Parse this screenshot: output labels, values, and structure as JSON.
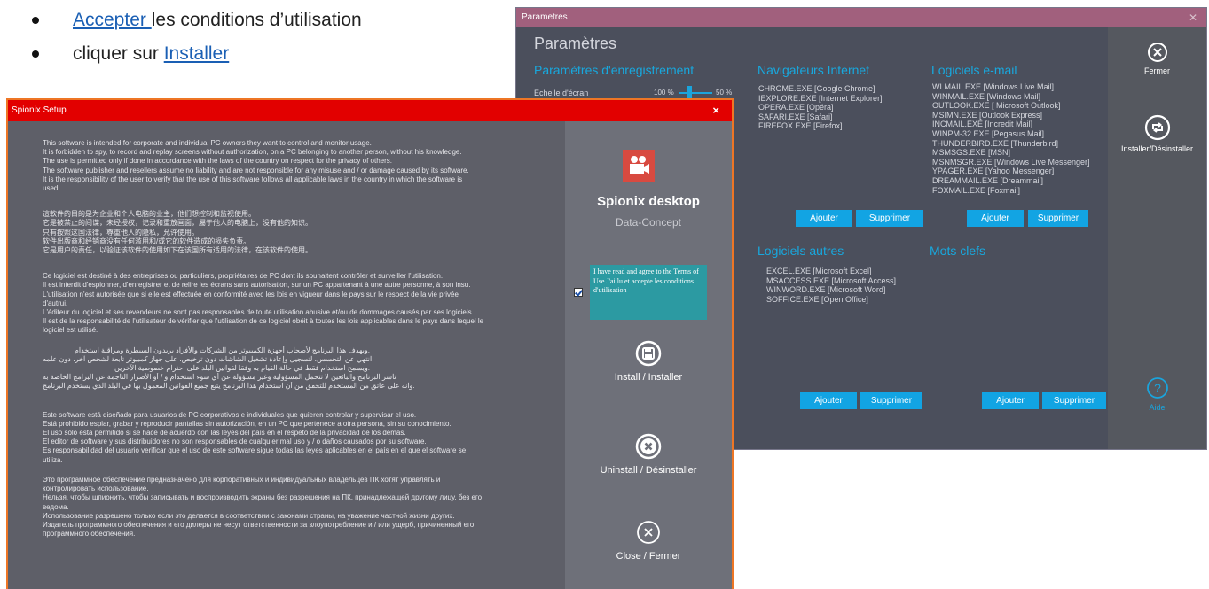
{
  "instructions": {
    "item1": {
      "link": "Accepter ",
      "text": "les conditions d’utilisation"
    },
    "item2": {
      "text": "cliquer sur ",
      "link": "Installer"
    }
  },
  "params": {
    "window_title": "Parametres",
    "page_title": "Paramètres",
    "recording_section": "Paramètres d'enregistrement",
    "scale_label": "Echelle d'écran",
    "scale_value_left": "100 %",
    "scale_value_right": "50 %",
    "browsers_section": "Navigateurs Internet",
    "browsers": [
      "CHROME.EXE [Google Chrome]",
      "IEXPLORE.EXE [Internet Explorer]",
      "OPERA.EXE [Opéra]",
      "SAFARI.EXE [Safari]",
      "FIREFOX.EXE [Firefox]"
    ],
    "email_section": "Logiciels e-mail",
    "email_clients": [
      "WLMAIL.EXE [Windows Live Mail]",
      "WINMAIL.EXE [Windows Mail]",
      "OUTLOOK.EXE [ Microsoft Outlook]",
      "MSIMN.EXE [Outlook Express]",
      "INCMAIL.EXE [Incredit Mail]",
      "WINPM-32.EXE [Pegasus Mail]",
      "THUNDERBIRD.EXE [Thunderbird]",
      "MSMSGS.EXE [MSN]",
      "MSNMSGR.EXE [Windows Live Messenger]",
      "YPAGER.EXE [Yahoo Messenger]",
      "DREAMMAIL.EXE [Dreammail]",
      "FOXMAIL.EXE [Foxmail]"
    ],
    "other_section": "Logiciels autres",
    "other_software": [
      "EXCEL.EXE [Microsoft Excel]",
      "MSACCESS.EXE [Microsoft Access]",
      "WINWORD.EXE [Microsoft Word]",
      "SOFFICE.EXE [Open Office]"
    ],
    "keywords_section": "Mots clefs",
    "add_label": "Ajouter",
    "remove_label": "Supprimer",
    "close_label": "Fermer",
    "install_uninstall_label": "Installer/Désinstaller",
    "help_label": "Aide"
  },
  "setup": {
    "window_title": "Spionix Setup",
    "close_x": "×",
    "english": [
      "This software is intended for corporate and individual PC owners they want to control and monitor usage.",
      "It is forbidden to spy, to record and replay screens without authorization, on a PC belonging to another person, without his knowledge.",
      "The use is permitted only if done in accordance with the laws of the country on respect for the privacy of others.",
      "The software publisher and resellers assume no liability and are not responsible for any misuse and / or damage caused by its software.",
      "It is the responsibility of the user to verify that the use of this software follows all applicable laws in the country in which the software is",
      "used."
    ],
    "chinese": [
      "這軟件的目的是为企业和个人电脑的业主，他们想控制和监视使用。",
      "它是被禁止的间谍，未经授权，记录和重放画面，屬于他人的电脑上，没有他的知识。",
      "只有按照这国法律，尊重他人的隐私，允许使用。",
      "软件出版商和经销商没有任何滥用和/或它的软件造成的损失负责。",
      "它是用户的责任，以验证该软件的使用如下在该国所有适用的法律，在该软件的使用。"
    ],
    "french": [
      "Ce logiciel est destiné à des entreprises ou particuliers, propriétaires de PC dont ils souhaitent contrôler et surveiller l'utilisation.",
      "Il est interdit d'espionner, d'enregistrer et de relire les écrans sans autorisation, sur un PC appartenant à une autre personne, à son insu.",
      "L'utilisation n'est autorisée que  si elle est effectuée en conformité avec les lois en vigueur dans le pays sur le respect de la vie privée",
      "d'autrui.",
      "L'éditeur du logiciel et ses revendeurs ne sont pas responsables de toute utilisation abusive et/ou de dommages causés par ses logiciels.",
      "Il est de la responsabilité de l'utilisateur de vérifier que l'utilisation de ce logiciel obéit à toutes les lois applicables dans le pays dans lequel le",
      "logiciel est utilisé."
    ],
    "arabic": [
      "ويهدف هذا البرنامج لأصحاب أجهزة الكمبيوتر من الشركات والأفراد يريدون السيطرة ومراقبة استخدام.",
      "انتهي عن التجسس، لتسجيل وإعادة تشغيل الشاشات دون ترخيص، على جهاز كمبيوتر تابعة لشخص آخر، دون علمه",
      "ويسمح استخدام فقط في حالة القيام به وفقا لقوانين البلد على احترام خصوصية الآخرين.",
      "ناشر البرنامج والبائعين لا تتحمل المسؤولية وغير مسؤولة عن أي سوء استخدام و / أو الأضرار الناجمة عن البرامج الخاصة به",
      "وانه على عاتق من المستخدم للتحقق من أن استخدام هذا البرنامج يتبع جميع القوانين المعمول بها في البلد الذي يستخدم البرنامج."
    ],
    "spanish": [
      "Este software está diseñado para usuarios de PC corporativos e individuales que quieren controlar y supervisar el uso.",
      "Está prohibido espiar, grabar y reproducir pantallas sin autorización, en un PC que pertenece a otra persona, sin su conocimiento.",
      "El uso sólo está permitido si se hace de acuerdo con las leyes del país en el respeto de la privacidad de los demás.",
      "El editor de software y sus distribuidores no son responsables de cualquier mal uso y / o daños causados por su software.",
      "Es responsabilidad del usuario verificar que el uso de este software sigue todas las leyes aplicables en el país en el que el software se",
      "utiliza."
    ],
    "russian": [
      "Это программное обеспечение предназначено для корпоративных и индивидуальных владельцев ПК хотят управлять и",
      "контролировать использование.",
      "Нельзя, чтобы шпионить, чтобы записывать и воспроизводить экраны без разрешения на ПК, принадлежащей другому лицу, без его",
      "ведома.",
      "Использование разрешено только если это делается в соответствии с законами страны, на уважение частной жизни других.",
      "Издатель программного обеспечения и его дилеры не несут ответственности за злоупотребление и / или ущерб, причиненный его",
      "программного обеспечения."
    ],
    "app_name": "Spionix desktop",
    "company": "Data-Concept",
    "agree_text": "I have read and agree to the Terms of Use J'ai lu et accepte les conditions d'utilisation",
    "install_label": "Install / Installer",
    "uninstall_label": "Uninstall / Désinstaller",
    "close_label": "Close / Fermer"
  }
}
